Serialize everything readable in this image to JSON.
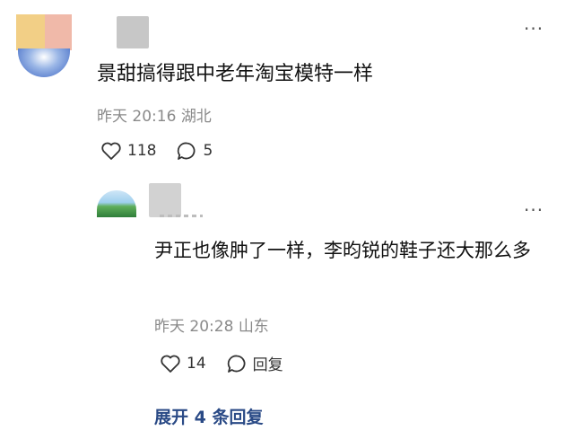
{
  "top_comment": {
    "text": "景甜搞得跟中老年淘宝模特一样",
    "time": "昨天 20:16",
    "location": "湖北",
    "likes": "118",
    "replies": "5",
    "more_label": "···"
  },
  "reply": {
    "text": "尹正也像肿了一样，李昀锐的鞋子还大那么多",
    "time": "昨天 20:28",
    "location": "山东",
    "likes": "14",
    "reply_label": "回复",
    "more_label": "···"
  },
  "expand_label": "展开 4 条回复",
  "colors": {
    "text": "#111111",
    "meta": "#8a8a8a",
    "expand_link": "#2a4a86",
    "redaction": "#c7c7c7"
  }
}
